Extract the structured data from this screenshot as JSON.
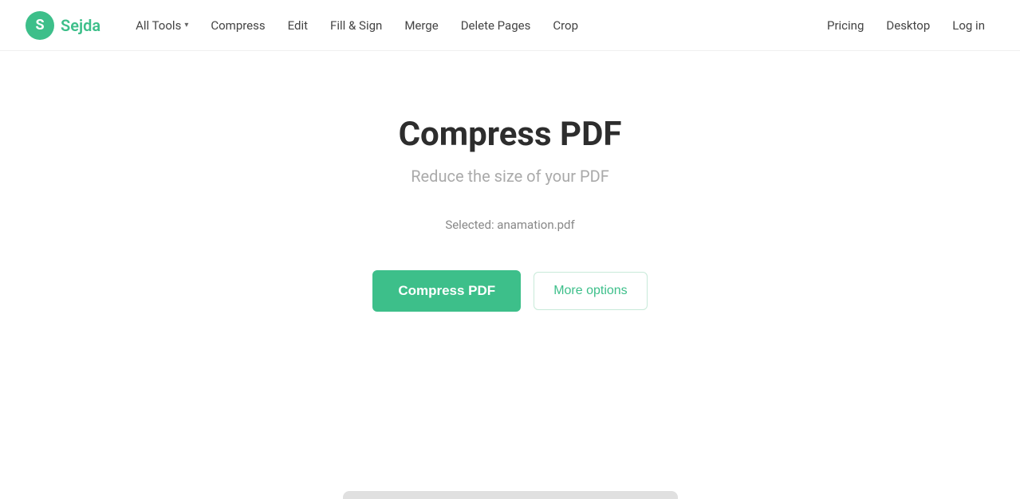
{
  "logo": {
    "icon_letter": "S",
    "name": "Sejda"
  },
  "nav": {
    "left_links": [
      {
        "label": "All Tools",
        "has_arrow": true
      },
      {
        "label": "Compress",
        "has_arrow": false
      },
      {
        "label": "Edit",
        "has_arrow": false
      },
      {
        "label": "Fill & Sign",
        "has_arrow": false
      },
      {
        "label": "Merge",
        "has_arrow": false
      },
      {
        "label": "Delete Pages",
        "has_arrow": false
      },
      {
        "label": "Crop",
        "has_arrow": false
      }
    ],
    "right_links": [
      {
        "label": "Pricing"
      },
      {
        "label": "Desktop"
      },
      {
        "label": "Log in"
      }
    ]
  },
  "main": {
    "title": "Compress PDF",
    "subtitle": "Reduce the size of your PDF",
    "selected_file": "Selected: anamation.pdf",
    "compress_button_label": "Compress PDF",
    "more_options_label": "More options"
  }
}
